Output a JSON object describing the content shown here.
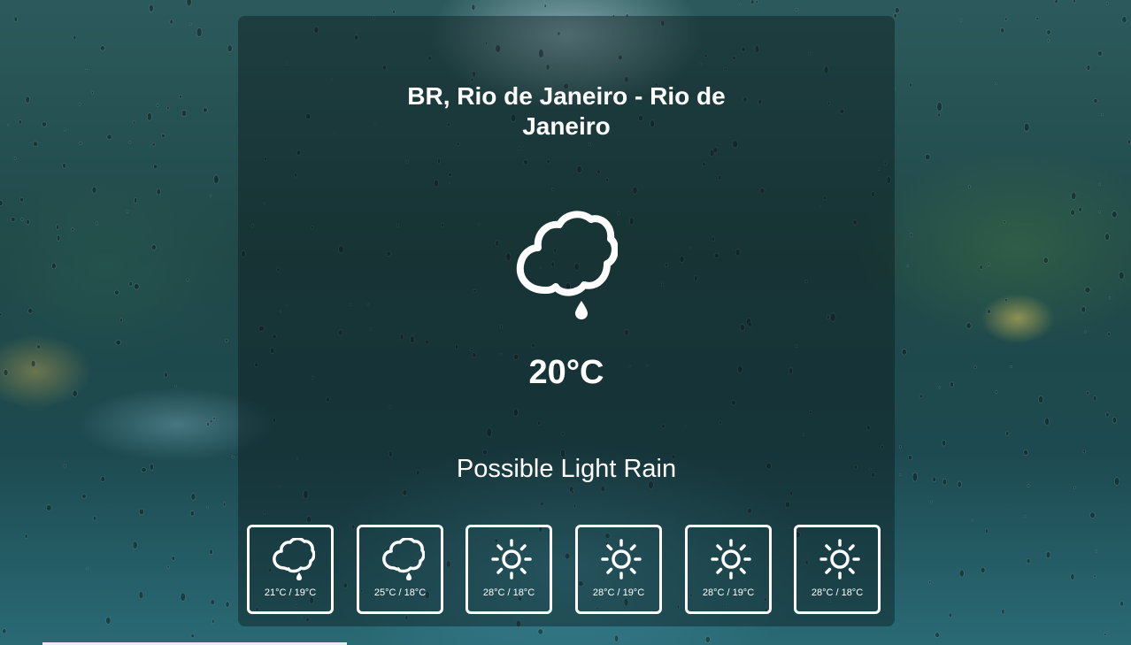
{
  "location": {
    "name": "BR, Rio de Janeiro - Rio de Janeiro"
  },
  "current": {
    "icon": "rain-cloud-icon",
    "temperature": "20°C",
    "description": "Possible Light Rain"
  },
  "forecast": [
    {
      "icon": "rain-cloud-icon",
      "range": "21°C / 19°C"
    },
    {
      "icon": "rain-cloud-icon",
      "range": "25°C / 18°C"
    },
    {
      "icon": "sun-icon",
      "range": "28°C / 18°C"
    },
    {
      "icon": "sun-icon",
      "range": "28°C / 19°C"
    },
    {
      "icon": "sun-icon",
      "range": "28°C / 19°C"
    },
    {
      "icon": "sun-icon",
      "range": "28°C / 18°C"
    }
  ],
  "colors": {
    "text": "#ffffff",
    "card_overlay": "rgba(12,24,26,0.42)"
  }
}
